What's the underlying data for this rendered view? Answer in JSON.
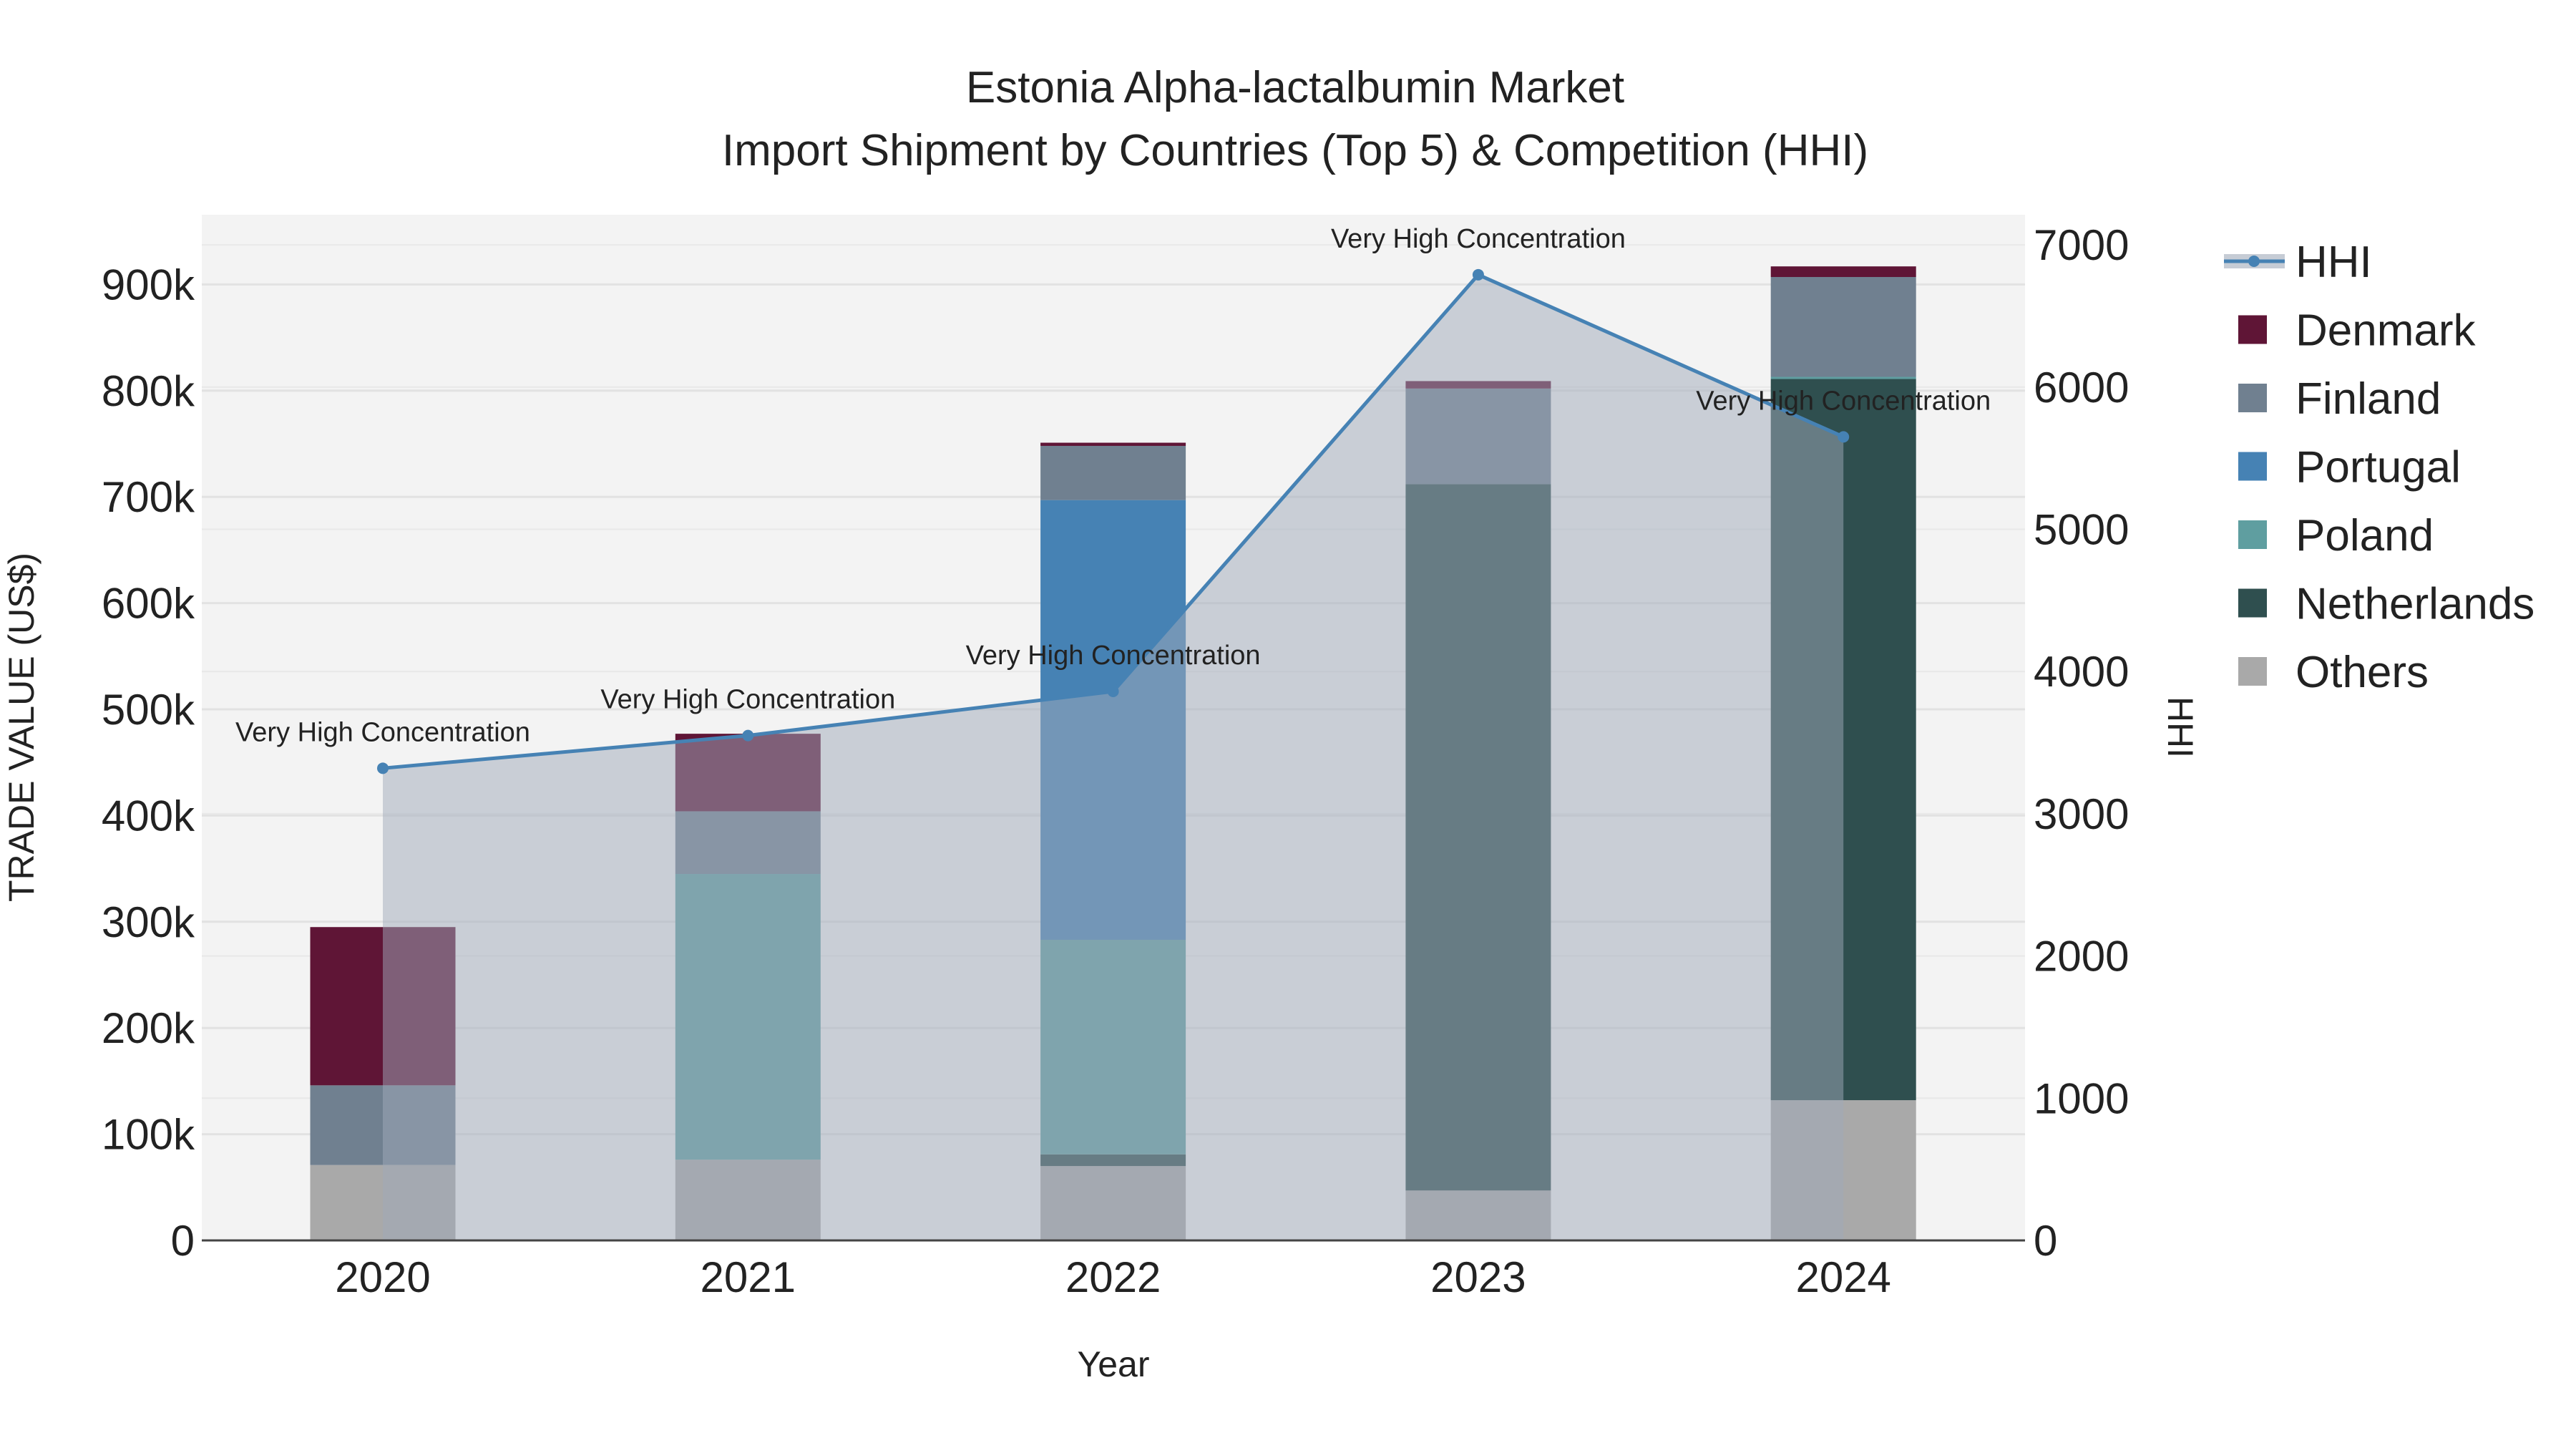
{
  "chart_data": {
    "type": "bar",
    "title": "Estonia Alpha-lactalbumin Market",
    "subtitle": "Import Shipment by Countries (Top 5) & Competition (HHI)",
    "xlabel": "Year",
    "ylabel": "TRADE VALUE (US$)",
    "y2label": "HHI",
    "categories": [
      "2020",
      "2021",
      "2022",
      "2023",
      "2024"
    ],
    "ylim": [
      0,
      960000
    ],
    "y2lim": [
      0,
      7200
    ],
    "yticks": [
      0,
      100000,
      200000,
      300000,
      400000,
      500000,
      600000,
      700000,
      800000,
      900000
    ],
    "ytick_labels": [
      "0",
      "100k",
      "200k",
      "300k",
      "400k",
      "500k",
      "600k",
      "700k",
      "800k",
      "900k"
    ],
    "y2ticks": [
      0,
      1000,
      2000,
      3000,
      4000,
      5000,
      6000,
      7000
    ],
    "y2tick_labels": [
      "0",
      "1000",
      "2000",
      "3000",
      "4000",
      "5000",
      "6000",
      "7000"
    ],
    "stacked": true,
    "series": [
      {
        "name": "Others",
        "color": "#a9a9a9",
        "values": [
          71000,
          76000,
          70000,
          47000,
          132000
        ]
      },
      {
        "name": "Netherlands",
        "color": "#2f4f4f",
        "values": [
          0,
          0,
          11000,
          665000,
          679000
        ]
      },
      {
        "name": "Poland",
        "color": "#5f9ea0",
        "values": [
          0,
          269000,
          202000,
          0,
          2000
        ]
      },
      {
        "name": "Portugal",
        "color": "#4682b4",
        "values": [
          0,
          0,
          414000,
          0,
          0
        ]
      },
      {
        "name": "Finland",
        "color": "#708090",
        "values": [
          75000,
          59000,
          51000,
          90000,
          94000
        ]
      },
      {
        "name": "Denmark",
        "color": "#5f1536",
        "values": [
          149000,
          73000,
          3000,
          7000,
          10000
        ]
      }
    ],
    "hhi": {
      "name": "HHI",
      "color": "#4682b4",
      "values": [
        3320,
        3550,
        3860,
        6790,
        5650
      ],
      "annotations": [
        "Very High Concentration",
        "Very High Concentration",
        "Very High Concentration",
        "Very High Concentration",
        "Very High Concentration"
      ]
    },
    "legend": {
      "placement": "right",
      "items": [
        "HHI",
        "Denmark",
        "Finland",
        "Portugal",
        "Poland",
        "Netherlands",
        "Others"
      ]
    },
    "grid": true
  }
}
